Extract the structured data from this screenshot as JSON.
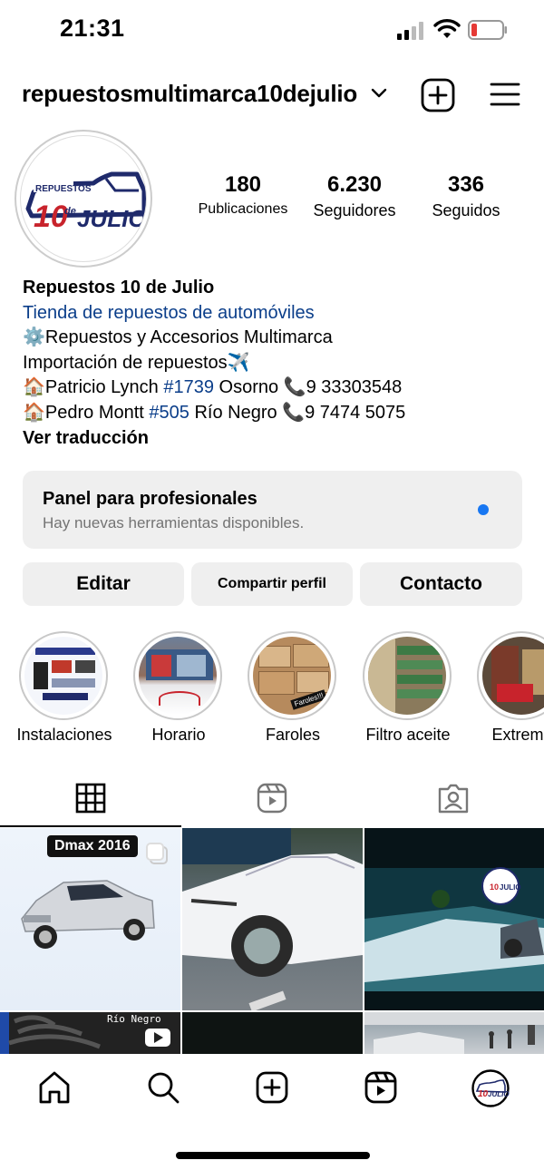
{
  "status_bar": {
    "time": "21:31"
  },
  "header": {
    "username": "repuestosmultimarca10dejulio"
  },
  "profile": {
    "logo_text_top": "REPUESTOS",
    "logo_text_main": "10 de JULIO",
    "stats": {
      "posts": {
        "value": "180",
        "label": "Publicaciones"
      },
      "followers": {
        "value": "6.230",
        "label": "Seguidores"
      },
      "following": {
        "value": "336",
        "label": "Seguidos"
      }
    }
  },
  "bio": {
    "name": "Repuestos 10 de Julio",
    "category": "Tienda de repuestos de automóviles",
    "line1": "⚙️Repuestos y Accesorios Multimarca",
    "line2": "Importación de repuestos✈️",
    "line3_a": "🏠Patricio Lynch ",
    "line3_tag": "#1739",
    "line3_b": " Osorno 📞9 33303548",
    "line4_a": "🏠Pedro Montt ",
    "line4_tag": "#505",
    "line4_b": " Río Negro 📞9 7474 5075",
    "translate": "Ver traducción"
  },
  "panel": {
    "title": "Panel para profesionales",
    "subtitle": "Hay nuevas herramientas disponibles."
  },
  "buttons": {
    "edit": "Editar",
    "share": "Compartir perfil",
    "contact": "Contacto"
  },
  "highlights": [
    {
      "label": "Instalaciones"
    },
    {
      "label": "Horario"
    },
    {
      "label": "Faroles"
    },
    {
      "label": "Filtro aceite"
    },
    {
      "label": "Extremo"
    }
  ],
  "posts": {
    "post1_badge": "Dmax 2016",
    "post4_label": "Río Negro",
    "highlight_faroles_tag": "Faroles!!!"
  },
  "colors": {
    "link": "#0b3e8a",
    "panel_bg": "#efefef",
    "dot": "#1877f2",
    "logo_navy": "#1f2a6b",
    "logo_red": "#c8232c"
  }
}
